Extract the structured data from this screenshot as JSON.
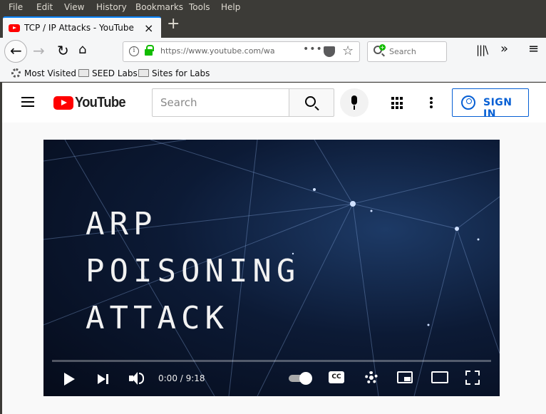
{
  "menubar": {
    "items": [
      "File",
      "Edit",
      "View",
      "History",
      "Bookmarks",
      "Tools",
      "Help"
    ]
  },
  "tab": {
    "title": "TCP / IP Attacks - YouTube",
    "close": "×",
    "new_tab": "+"
  },
  "nav": {
    "url": "https://www.youtube.com/watch",
    "url_actions": "•••",
    "search_placeholder": "Search"
  },
  "bookmarks": {
    "items": [
      "Most Visited",
      "SEED Labs",
      "Sites for Labs"
    ]
  },
  "youtube": {
    "logo_text": "YouTube",
    "search_placeholder": "Search",
    "sign_in": "SIGN IN"
  },
  "video": {
    "title_lines": [
      "ARP",
      "POISONING",
      "ATTACK"
    ],
    "time": "0:00 / 9:18",
    "progress": 0,
    "cc_label": "CC"
  },
  "colors": {
    "youtube_red": "#ff0000",
    "sign_in_blue": "#065fd4",
    "tab_accent": "#0a84ff",
    "lock_green": "#12bc00"
  }
}
